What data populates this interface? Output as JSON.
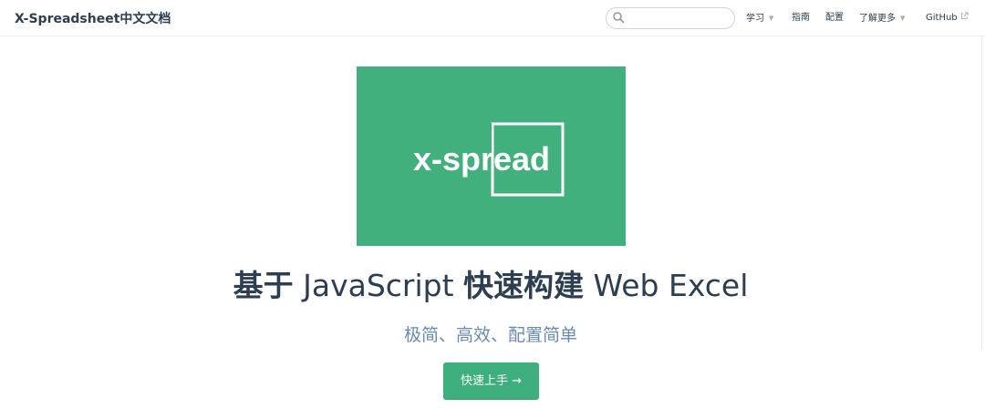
{
  "navbar": {
    "site_title": "X-Spreadsheet中文文档",
    "search": {
      "placeholder": "",
      "value": ""
    },
    "items": [
      {
        "label": "学习",
        "dropdown": true
      },
      {
        "label": "指南"
      },
      {
        "label": "配置"
      },
      {
        "label": "了解更多",
        "dropdown": true
      },
      {
        "label": "GitHub",
        "external": true
      }
    ]
  },
  "hero": {
    "logo_text": "x-spread",
    "logo_color": "#42b07c",
    "title_parts": [
      "基于",
      "JavaScript",
      "快速构建",
      "Web Excel"
    ],
    "description": "极简、高效、配置简单",
    "action_label": "快速上手 →",
    "action_color": "#3eaf7c"
  }
}
